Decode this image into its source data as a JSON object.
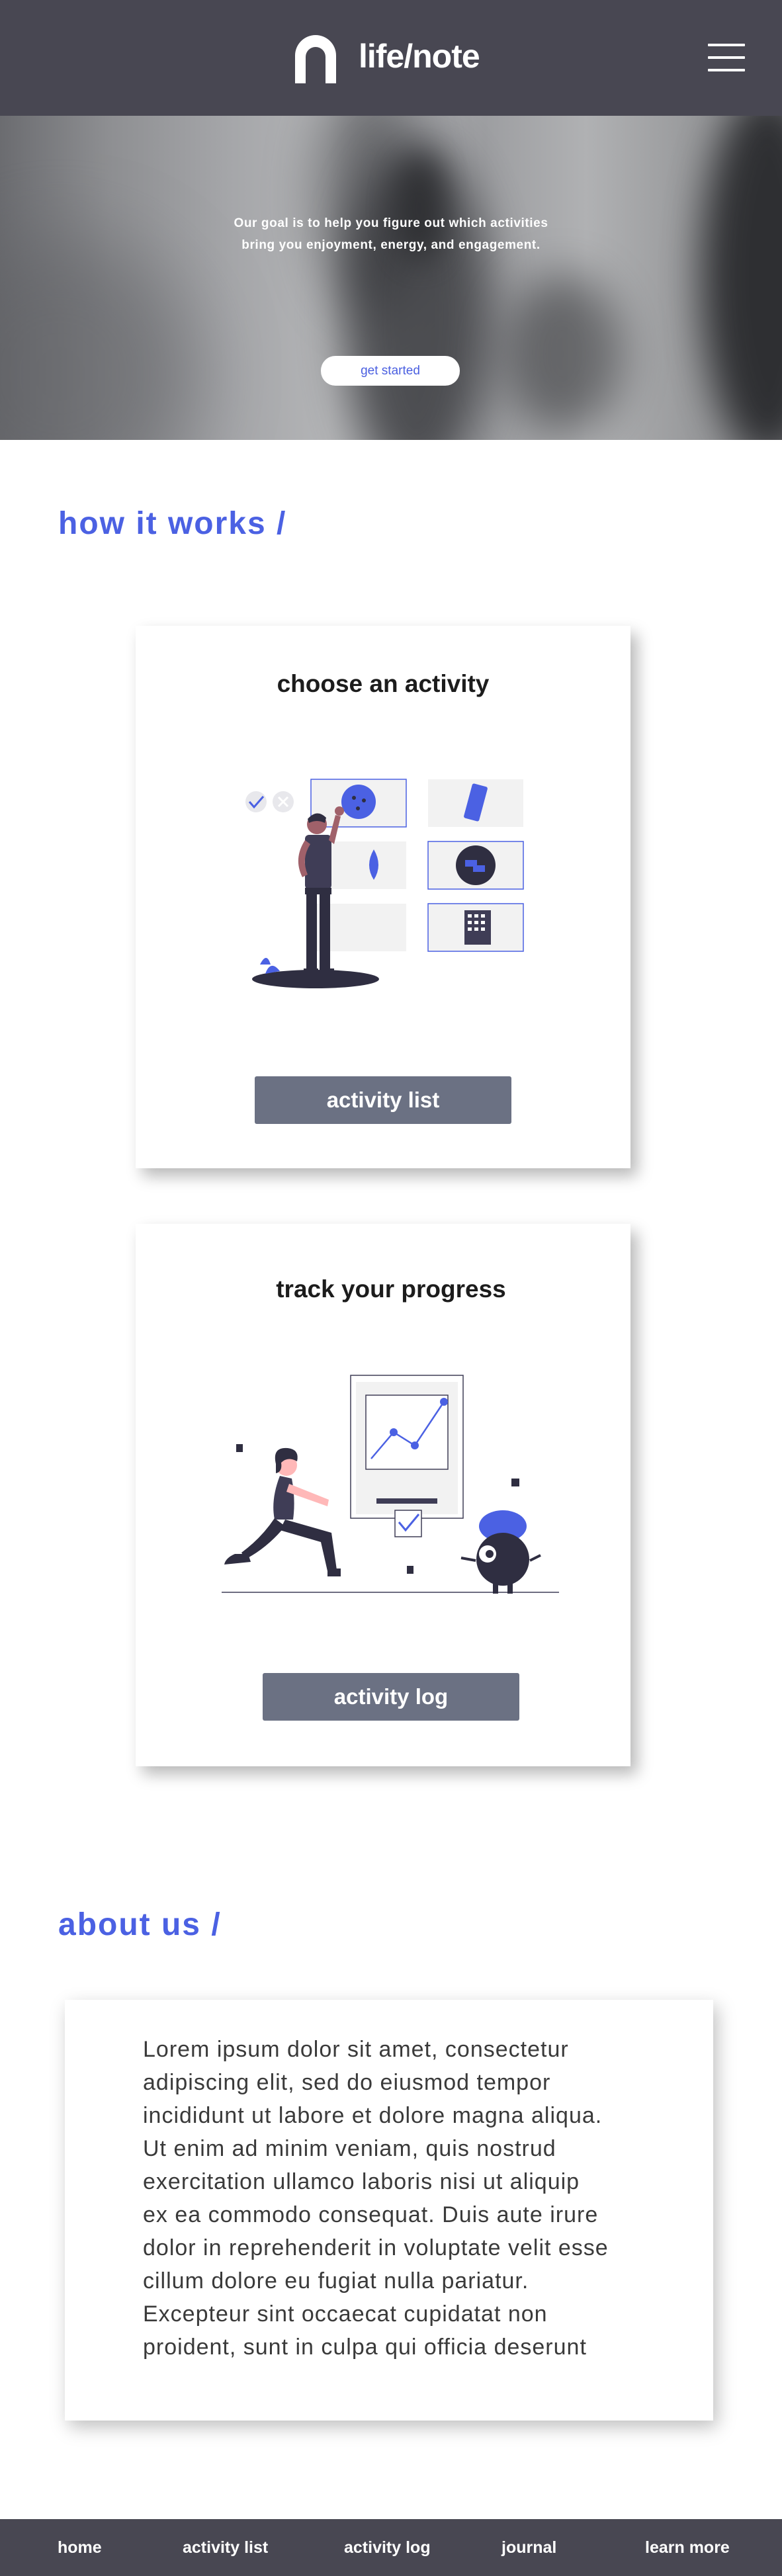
{
  "header": {
    "brand": "life/note",
    "menu_icon": "hamburger-menu-icon",
    "logo_icon": "arch-logo-icon"
  },
  "hero": {
    "lines": [
      "Our goal is to help you figure out which activities",
      "bring you enjoyment, energy, and engagement."
    ],
    "cta_label": "get started"
  },
  "how_it_works": {
    "title": "how it works /",
    "cards": [
      {
        "title": "choose an activity",
        "button_label": "activity list"
      },
      {
        "title": "track your progress",
        "button_label": "activity log"
      }
    ]
  },
  "about": {
    "title": "about us /",
    "lines": [
      "Lorem ipsum dolor sit amet, consectetur",
      "adipiscing elit, sed do eiusmod tempor",
      "incididunt ut labore et dolore magna aliqua.",
      "Ut enim ad minim veniam, quis nostrud",
      "exercitation ullamco laboris nisi ut aliquip",
      "ex ea commodo consequat. Duis aute irure",
      "dolor in reprehenderit in voluptate velit esse",
      "cillum dolore eu fugiat nulla pariatur.",
      "Excepteur sint occaecat cupidatat non",
      "proident, sunt in culpa qui officia deserunt"
    ]
  },
  "footer": {
    "links": [
      "home",
      "activity list",
      "activity log",
      "journal",
      "learn more"
    ]
  },
  "colors": {
    "accent": "#4b61e3",
    "header_bg": "#484752",
    "button_bg": "#6b7183"
  }
}
